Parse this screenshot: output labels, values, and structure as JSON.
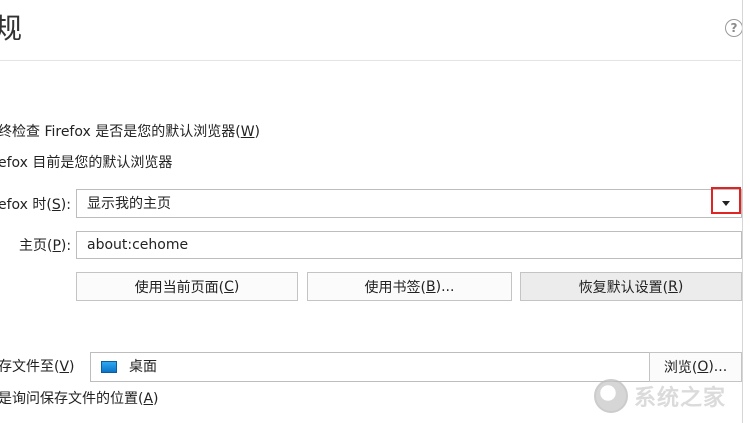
{
  "header": {
    "title": "规",
    "help_icon": "?"
  },
  "startup": {
    "check_default_label": "终检查 Firefox 是否是您的默认浏览器(",
    "check_default_key": "W",
    "check_default_tail": ")",
    "default_status": "efox 目前是您的默认浏览器",
    "on_start_label": "efox 时(",
    "on_start_key": "S",
    "on_start_tail": "):",
    "on_start_value": "显示我的主页",
    "homepage_label": "主页(",
    "homepage_key": "P",
    "homepage_tail": "):",
    "homepage_value": "about:cehome",
    "buttons": [
      {
        "label": "使用当前页面(",
        "key": "C",
        "tail": ")"
      },
      {
        "label": "使用书签(",
        "key": "B",
        "tail": ")..."
      },
      {
        "label": "恢复默认设置(",
        "key": "R",
        "tail": ")"
      }
    ]
  },
  "downloads": {
    "save_to_label": "存文件至(",
    "save_to_key": "V",
    "save_to_tail": ")",
    "folder_value": "桌面",
    "browse_label": "浏览(",
    "browse_key": "O",
    "browse_tail": ")...",
    "always_ask_label": "是询问保存文件的位置(",
    "always_ask_key": "A",
    "always_ask_tail": ")"
  },
  "watermark": {
    "text": "系统之家"
  },
  "colors": {
    "highlight": "#e02424",
    "folder_icon": "#1a8fe0"
  }
}
